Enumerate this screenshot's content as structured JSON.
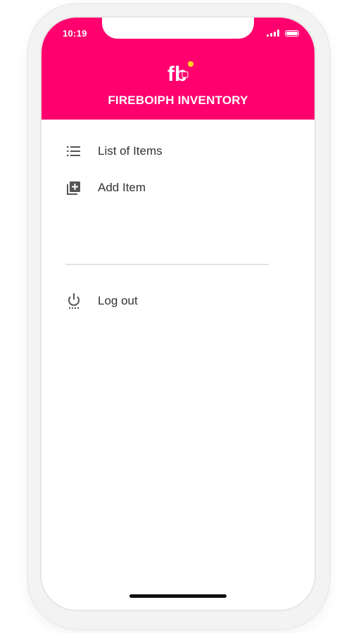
{
  "status_bar": {
    "time": "10:19"
  },
  "header": {
    "logo_text": "fb",
    "title": "FIREBOIPH INVENTORY",
    "background_color": "#ff006e"
  },
  "menu": {
    "items": [
      {
        "label": "List of Items",
        "icon": "list-icon"
      },
      {
        "label": "Add Item",
        "icon": "add-box-icon"
      }
    ],
    "logout": {
      "label": "Log out",
      "icon": "power-icon"
    }
  }
}
